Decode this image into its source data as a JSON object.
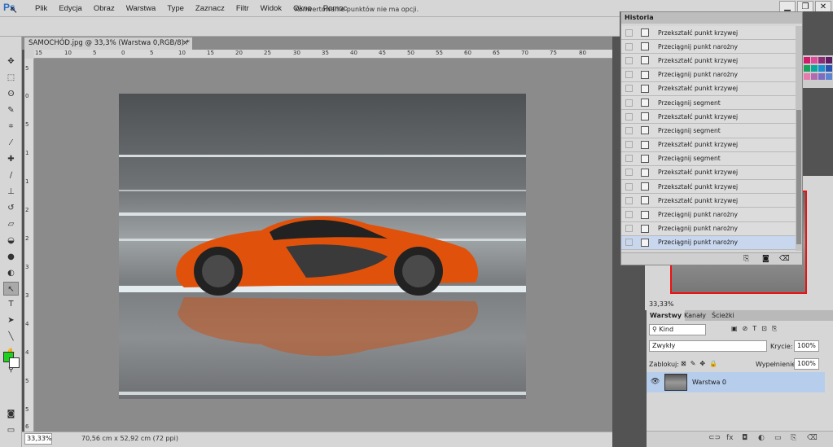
{
  "app": {
    "logo": "Ps"
  },
  "menu": [
    "Plik",
    "Edycja",
    "Obraz",
    "Warstwa",
    "Type",
    "Zaznacz",
    "Filtr",
    "Widok",
    "Okno",
    "Pomoc"
  ],
  "options_bar": {
    "message": "Konwertowanie punktów nie ma opcji."
  },
  "document": {
    "tab_title": "SAMOCHÓD.jpg @ 33,3% (Warstwa 0,RGB/8) *",
    "close": "×"
  },
  "ruler_top": [
    "15",
    "10",
    "5",
    "0",
    "5",
    "10",
    "15",
    "20",
    "25",
    "30",
    "35",
    "40",
    "45",
    "50",
    "55",
    "60",
    "65",
    "70",
    "75",
    "80"
  ],
  "ruler_left": [
    "5",
    "0",
    "5",
    "1",
    "1",
    "2",
    "2",
    "3",
    "3",
    "4",
    "4",
    "5",
    "5",
    "6"
  ],
  "status": {
    "zoom": "33,33%",
    "doc_info": "70,56 cm x 52,92 cm (72 ppi)"
  },
  "history": {
    "title": "Historia",
    "items": [
      "Przekształć punkt krzywej",
      "Przeciągnij punkt narożny",
      "Przekształć punkt krzywej",
      "Przeciągnij punkt narożny",
      "Przekształć punkt krzywej",
      "Przeciągnij segment",
      "Przekształć punkt krzywej",
      "Przeciągnij segment",
      "Przekształć punkt krzywej",
      "Przeciągnij segment",
      "Przekształć punkt krzywej",
      "Przekształć punkt krzywej",
      "Przekształć punkt krzywej",
      "Przeciągnij punkt narożny",
      "Przeciągnij punkt narożny",
      "Przeciągnij punkt narożny"
    ],
    "selected_index": 15
  },
  "navigator": {
    "zoom": "33,33%"
  },
  "layers": {
    "tabs": [
      "Warstwy",
      "Kanały",
      "Ścieżki"
    ],
    "kind_filter": "Kind",
    "blend_mode": "Zwykły",
    "opacity_label": "Krycie:",
    "opacity": "100%",
    "lock_label": "Zablokuj:",
    "fill_label": "Wypełnienie:",
    "fill": "100%",
    "layer_name": "Warstwa 0"
  },
  "colors": {
    "foreground": "#1fd11f",
    "background": "#ffffff",
    "accent_selection": "#b7cdec"
  }
}
